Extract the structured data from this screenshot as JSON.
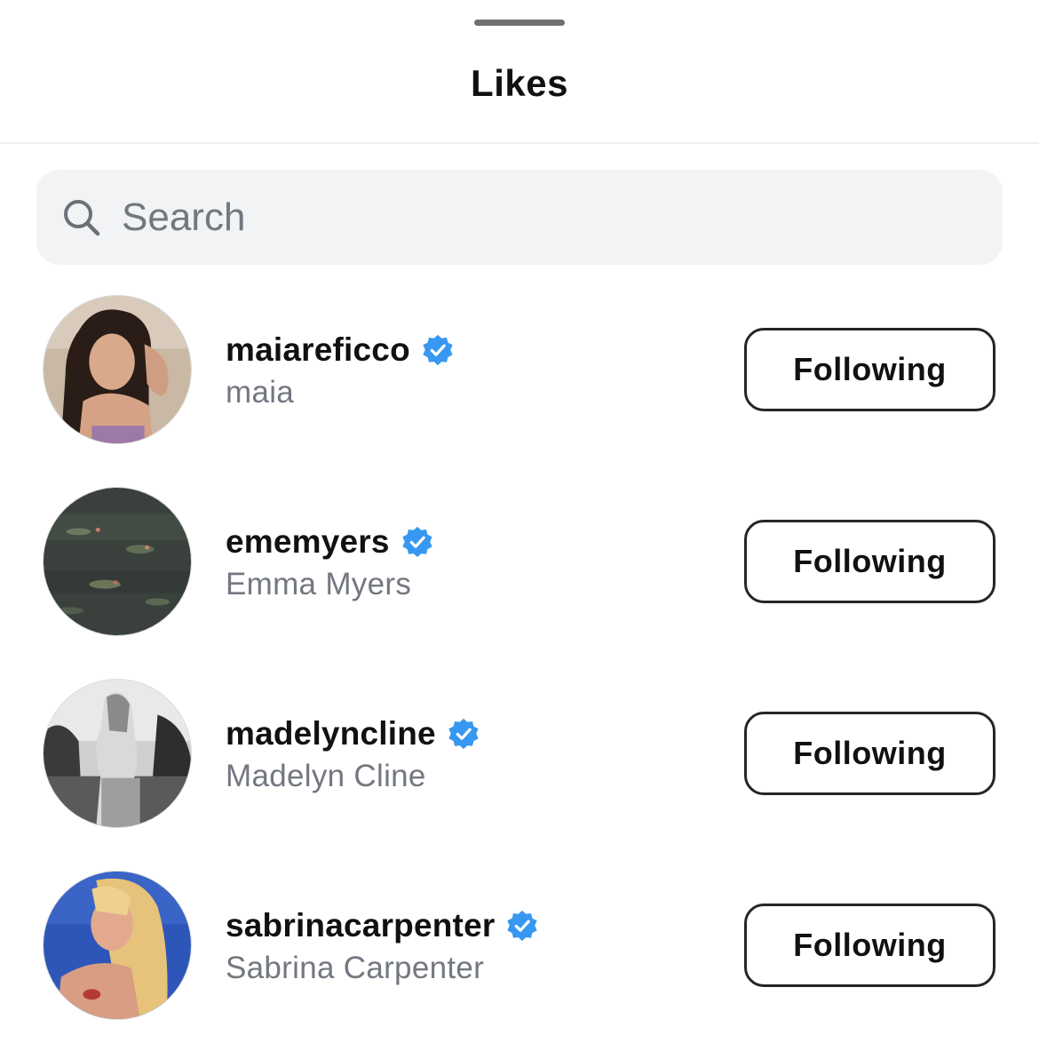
{
  "header": {
    "title": "Likes"
  },
  "search": {
    "placeholder": "Search",
    "icon": "search-icon"
  },
  "colors": {
    "verified": "#3897f0",
    "secondary_text": "#737780",
    "search_background": "#f2f3f5"
  },
  "likes": [
    {
      "username": "maiareficco",
      "full_name": "maia",
      "verified": true,
      "button_label": "Following"
    },
    {
      "username": "ememyers",
      "full_name": "Emma Myers",
      "verified": true,
      "button_label": "Following"
    },
    {
      "username": "madelyncline",
      "full_name": "Madelyn Cline",
      "verified": true,
      "button_label": "Following"
    },
    {
      "username": "sabrinacarpenter",
      "full_name": "Sabrina Carpenter",
      "verified": true,
      "button_label": "Following"
    }
  ]
}
